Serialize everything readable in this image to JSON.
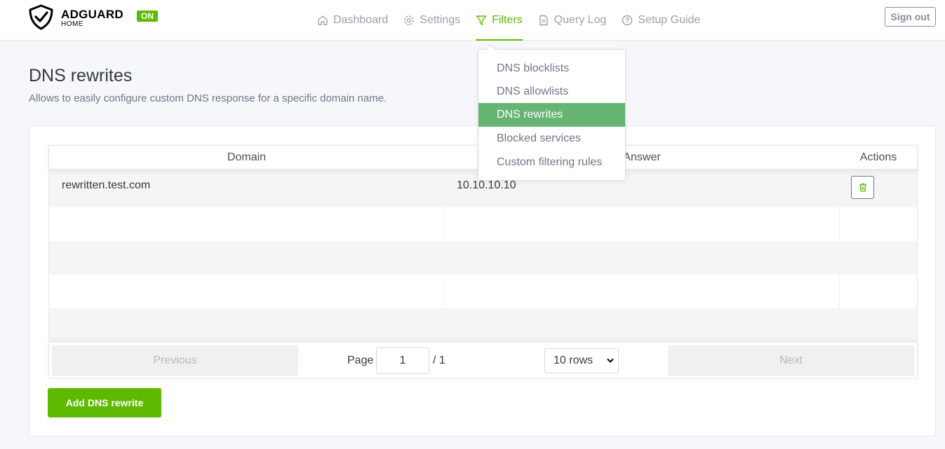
{
  "header": {
    "logo_name": "ADGUARD",
    "logo_sub": "HOME",
    "status_badge": "ON",
    "nav": [
      {
        "label": "Dashboard",
        "icon": "home-icon"
      },
      {
        "label": "Settings",
        "icon": "gear-icon"
      },
      {
        "label": "Filters",
        "icon": "filter-icon",
        "active": true
      },
      {
        "label": "Query Log",
        "icon": "document-icon"
      },
      {
        "label": "Setup Guide",
        "icon": "help-circle-icon"
      }
    ],
    "sign_out": "Sign out"
  },
  "filters_menu": {
    "items": [
      {
        "label": "DNS blocklists"
      },
      {
        "label": "DNS allowlists"
      },
      {
        "label": "DNS rewrites",
        "active": true
      },
      {
        "label": "Blocked services"
      },
      {
        "label": "Custom filtering rules"
      }
    ]
  },
  "page": {
    "title": "DNS rewrites",
    "description": "Allows to easily configure custom DNS response for a specific domain name."
  },
  "table": {
    "columns": [
      "Domain",
      "Answer",
      "Actions"
    ],
    "rows": [
      {
        "domain": "rewritten.test.com",
        "answer": "10.10.10.10",
        "action_icon": "trash-icon"
      }
    ]
  },
  "pagination": {
    "previous": "Previous",
    "page_label": "Page",
    "current_page": "1",
    "total_pages": "/ 1",
    "rows_per_page": "10 rows",
    "next": "Next"
  },
  "add_button": "Add DNS rewrite",
  "colors": {
    "accent": "#5eba00",
    "menu_active": "#66b574"
  }
}
